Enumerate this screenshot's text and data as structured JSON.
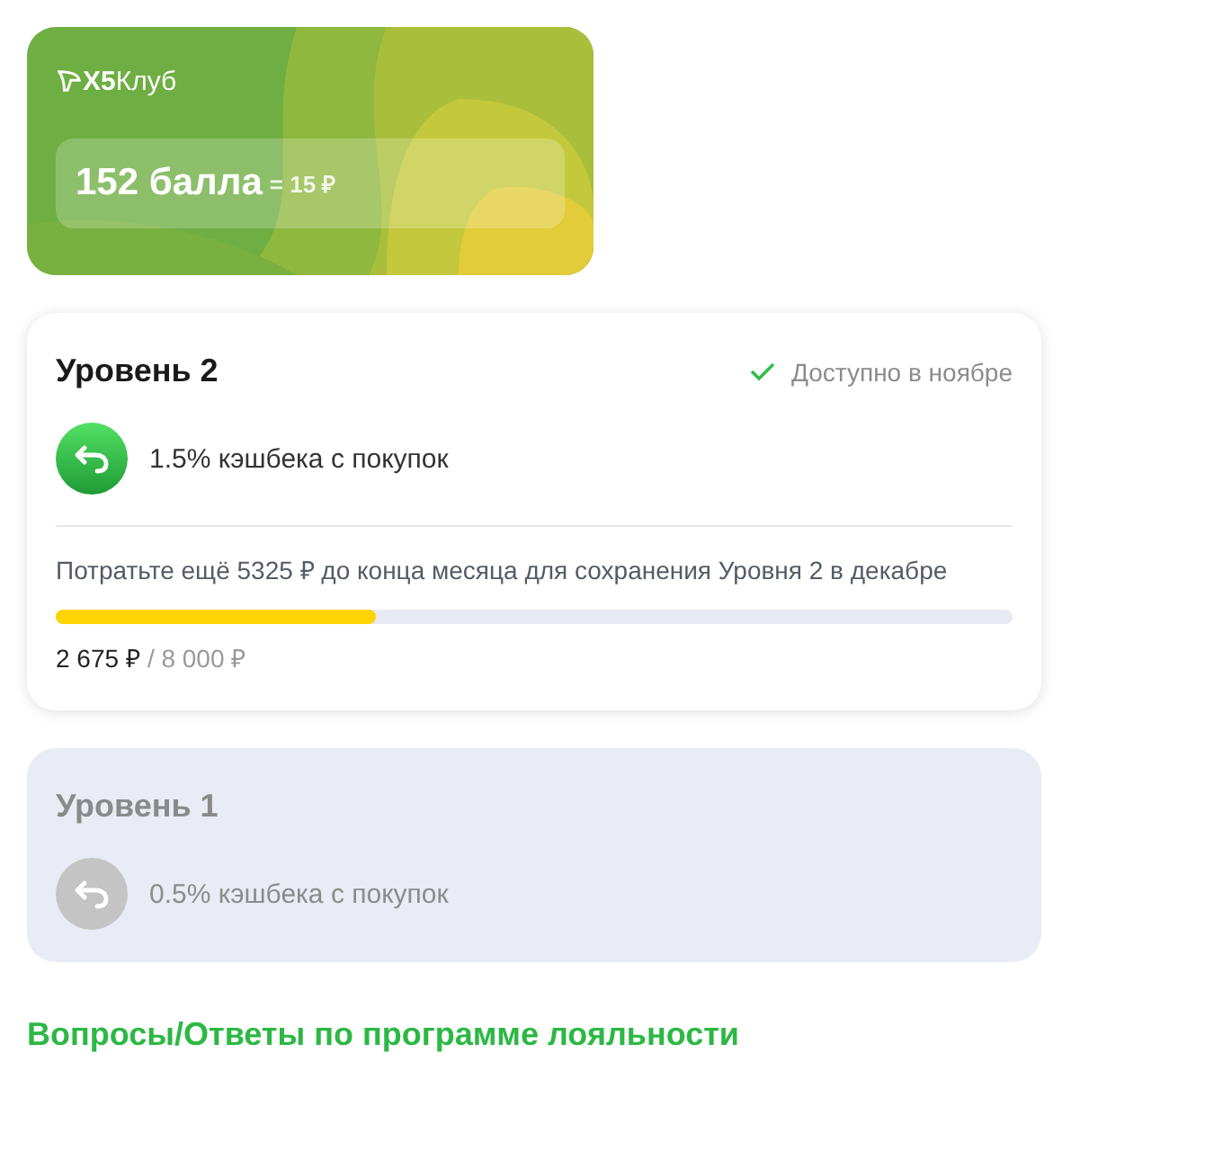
{
  "loyalty_card": {
    "logo": "**X5**Клуб",
    "points": "152 балла",
    "equivalent": "= 15 ₽"
  },
  "levels": [
    {
      "title": "Уровень 2",
      "active": true,
      "status": "Доступно в ноябре",
      "cashback": "1.5% кэшбека с покупок",
      "hint": "Потратьте ещё 5325 ₽ до конца месяца для сохранения Уровня 2 в декабре",
      "progress": {
        "level": 0.334,
        "spent": "2 675 ₽",
        "target": "/ 8 000 ₽"
      }
    },
    {
      "title": "Уровень 1",
      "active": false,
      "cashback": "0.5% кэшбека с покупок"
    }
  ],
  "faq_link": "Вопросы/Ответы по программе лояльности"
}
